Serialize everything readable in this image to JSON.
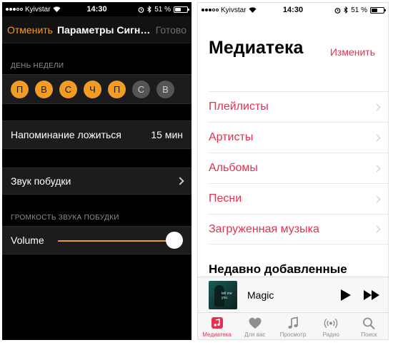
{
  "colors": {
    "accent_orange": "#f39c25",
    "accent_pink": "#e5304e",
    "dark_bg": "#000000",
    "dark_cell": "#1c1c1e"
  },
  "left": {
    "status": {
      "carrier": "Kyivstar",
      "time": "14:30",
      "battery": "51 %",
      "battery_level": 0.51
    },
    "nav": {
      "cancel": "Отменить",
      "title": "Параметры Сигн…",
      "done": "Готово"
    },
    "weekday_header": "ДЕНЬ НЕДЕЛИ",
    "days": [
      {
        "label": "П",
        "on": true
      },
      {
        "label": "В",
        "on": true
      },
      {
        "label": "С",
        "on": true
      },
      {
        "label": "Ч",
        "on": true
      },
      {
        "label": "П",
        "on": true
      },
      {
        "label": "С",
        "on": false
      },
      {
        "label": "В",
        "on": false
      }
    ],
    "bedtime": {
      "label": "Напоминание ложиться",
      "value": "15 мин"
    },
    "wake_sound": {
      "label": "Звук побудки"
    },
    "volume_header": "ГРОМКОСТЬ ЗВУКА ПОБУДКИ",
    "volume": {
      "label": "Volume",
      "level": 1.0
    }
  },
  "right": {
    "status": {
      "carrier": "Kyivstar",
      "time": "14:30",
      "battery": "51 %",
      "battery_level": 0.51
    },
    "title": "Медиатека",
    "edit": "Изменить",
    "items": [
      {
        "label": "Плейлисты"
      },
      {
        "label": "Артисты"
      },
      {
        "label": "Альбомы"
      },
      {
        "label": "Песни"
      },
      {
        "label": "Загруженная музыка"
      }
    ],
    "recent_title": "Недавно добавленные",
    "player": {
      "song": "Magic",
      "art_text": "tell me you"
    },
    "tabs": [
      {
        "label": "Медиатека",
        "icon": "music-note-icon",
        "active": true
      },
      {
        "label": "Для вас",
        "icon": "heart-icon",
        "active": false
      },
      {
        "label": "Просмотр",
        "icon": "note-icon",
        "active": false
      },
      {
        "label": "Радио",
        "icon": "radio-icon",
        "active": false
      },
      {
        "label": "Поиск",
        "icon": "search-icon",
        "active": false
      }
    ]
  }
}
